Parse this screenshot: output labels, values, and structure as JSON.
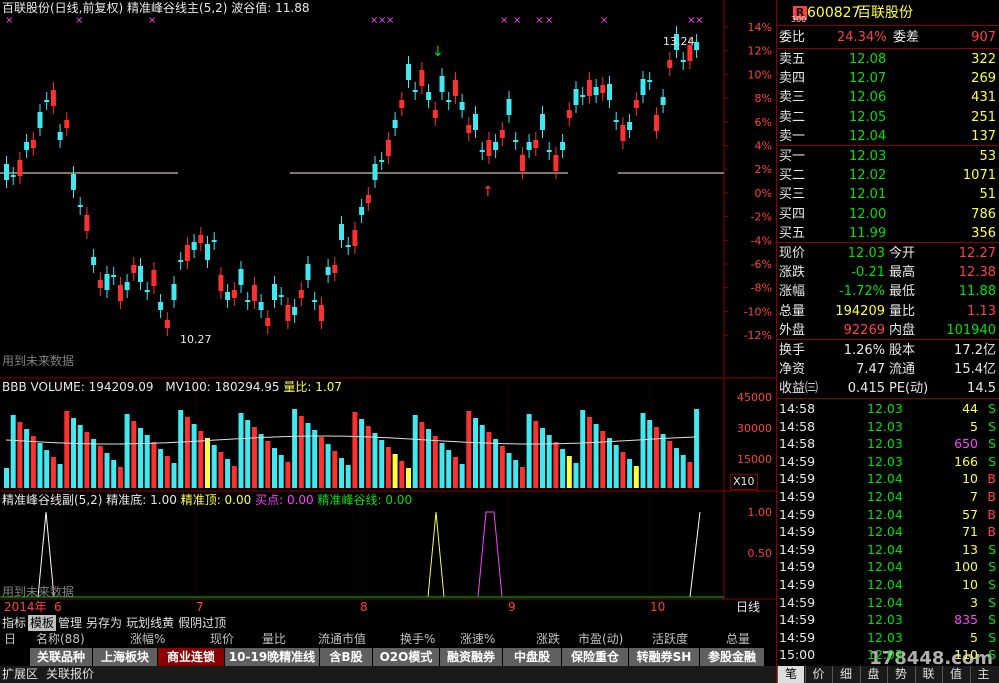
{
  "main_chart": {
    "title": "百联股份(日线,前复权)",
    "indicator_name": "精准峰谷线主(5,2)",
    "wave_label": "波谷值: 11.88",
    "price_high_label": "13.24",
    "price_low_label": "10.27",
    "future_data_label": "用到未来数据",
    "y_ticks": [
      "14%",
      "12%",
      "10%",
      "8%",
      "6%",
      "4%",
      "2%",
      "0%",
      "-2%",
      "-4%",
      "-6%",
      "-8%",
      "-10%",
      "-12%"
    ]
  },
  "volume_panel": {
    "volume_label": "BBB VOLUME: 194209.09",
    "mv_label": "MV100: 180294.95",
    "ratio_label": "量比: 1.07",
    "y_ticks": [
      "45000",
      "30000",
      "15000"
    ],
    "unit": "X10"
  },
  "sub_panel": {
    "name": "精准峰谷线副(5,2)",
    "bottom_label": "精准底: 1.00",
    "top_label": "精准顶: 0.00",
    "buy_label": "买点: 0.00",
    "line_label": "精准峰谷线: 0.00",
    "future_data_label": "用到未来数据",
    "y_ticks": [
      "1.00",
      "0.50"
    ]
  },
  "date_axis": {
    "labels": [
      "2014年",
      "6",
      "7",
      "8",
      "9",
      "10"
    ],
    "period": "日线"
  },
  "toolbar": {
    "items": [
      "指标",
      "模板",
      "管理",
      "另存为",
      "玩划线黄",
      "假阴过顶"
    ],
    "active_index": 1
  },
  "column_header": {
    "items": [
      "日",
      "名称(88)",
      "涨幅%",
      "现价",
      "量比",
      "流通市值",
      "换手%",
      "涨速%",
      "涨跌",
      "市盈(动)",
      "活跃度",
      "总量"
    ]
  },
  "tabs": {
    "items": [
      "关联品种",
      "上海板块",
      "商业连锁",
      "10-19晚精准线",
      "含B股",
      "O2O模式",
      "融资融券",
      "中盘股",
      "保险重仓",
      "转融券SH",
      "参股金融"
    ],
    "active_index": 2
  },
  "statusbar": {
    "left1": "扩展区",
    "left2": "关联报价",
    "right_tabs": [
      "笔",
      "价",
      "细",
      "盘",
      "势",
      "联",
      "值",
      "主"
    ],
    "watermark": "178448.com"
  },
  "quote": {
    "code": "600827",
    "name": "百联股份",
    "badge_r": "R",
    "badge_num": "300",
    "weibi_label": "委比",
    "weibi_value": "24.34%",
    "weicha_label": "委差",
    "weicha_value": "907",
    "asks": [
      {
        "label": "卖五",
        "price": "12.08",
        "vol": "322"
      },
      {
        "label": "卖四",
        "price": "12.07",
        "vol": "269"
      },
      {
        "label": "卖三",
        "price": "12.06",
        "vol": "431"
      },
      {
        "label": "卖二",
        "price": "12.05",
        "vol": "251"
      },
      {
        "label": "卖一",
        "price": "12.04",
        "vol": "137"
      }
    ],
    "bids": [
      {
        "label": "买一",
        "price": "12.03",
        "vol": "53"
      },
      {
        "label": "买二",
        "price": "12.02",
        "vol": "1071"
      },
      {
        "label": "买三",
        "price": "12.01",
        "vol": "51"
      },
      {
        "label": "买四",
        "price": "12.00",
        "vol": "786"
      },
      {
        "label": "买五",
        "price": "11.99",
        "vol": "356"
      }
    ],
    "stats": [
      {
        "l1": "现价",
        "v1": "12.03",
        "c1": "grn",
        "l2": "今开",
        "v2": "12.27",
        "c2": "red"
      },
      {
        "l1": "涨跌",
        "v1": "-0.21",
        "c1": "grn",
        "l2": "最高",
        "v2": "12.38",
        "c2": "red"
      },
      {
        "l1": "涨幅",
        "v1": "-1.72%",
        "c1": "grn",
        "l2": "最低",
        "v2": "11.88",
        "c2": "grn"
      },
      {
        "l1": "总量",
        "v1": "194209",
        "c1": "yel",
        "l2": "量比",
        "v2": "1.13",
        "c2": "red"
      },
      {
        "l1": "外盘",
        "v1": "92269",
        "c1": "red",
        "l2": "内盘",
        "v2": "101940",
        "c2": "grn"
      }
    ],
    "stats2": [
      {
        "l1": "换手",
        "v1": "1.26%",
        "l2": "股本",
        "v2": "17.2亿"
      },
      {
        "l1": "净资",
        "v1": "7.47",
        "l2": "流通",
        "v2": "15.4亿"
      },
      {
        "l1": "收益㈢",
        "v1": "0.415",
        "l2": "PE(动)",
        "v2": "14.5"
      }
    ],
    "ticks": [
      {
        "t": "14:58",
        "p": "12.03",
        "pc": "grn",
        "v": "44",
        "vc": "yel",
        "s": "S"
      },
      {
        "t": "14:58",
        "p": "12.03",
        "pc": "grn",
        "v": "5",
        "vc": "yel",
        "s": "S"
      },
      {
        "t": "14:58",
        "p": "12.03",
        "pc": "grn",
        "v": "650",
        "vc": "mag",
        "s": "S"
      },
      {
        "t": "14:59",
        "p": "12.03",
        "pc": "grn",
        "v": "166",
        "vc": "yel",
        "s": "S"
      },
      {
        "t": "14:59",
        "p": "12.04",
        "pc": "grn",
        "v": "10",
        "vc": "yel",
        "s": "B"
      },
      {
        "t": "14:59",
        "p": "12.04",
        "pc": "grn",
        "v": "7",
        "vc": "yel",
        "s": "B"
      },
      {
        "t": "14:59",
        "p": "12.04",
        "pc": "grn",
        "v": "57",
        "vc": "yel",
        "s": "B"
      },
      {
        "t": "14:59",
        "p": "12.04",
        "pc": "grn",
        "v": "71",
        "vc": "yel",
        "s": "B"
      },
      {
        "t": "14:59",
        "p": "12.04",
        "pc": "grn",
        "v": "13",
        "vc": "yel",
        "s": "S"
      },
      {
        "t": "14:59",
        "p": "12.04",
        "pc": "grn",
        "v": "100",
        "vc": "yel",
        "s": "S"
      },
      {
        "t": "14:59",
        "p": "12.04",
        "pc": "grn",
        "v": "10",
        "vc": "yel",
        "s": "S"
      },
      {
        "t": "14:59",
        "p": "12.04",
        "pc": "grn",
        "v": "3",
        "vc": "yel",
        "s": "S"
      },
      {
        "t": "14:59",
        "p": "12.03",
        "pc": "grn",
        "v": "835",
        "vc": "mag",
        "s": "S"
      },
      {
        "t": "14:59",
        "p": "12.03",
        "pc": "grn",
        "v": "5",
        "vc": "yel",
        "s": "S"
      },
      {
        "t": "15:00",
        "p": "12.03",
        "pc": "grn",
        "v": "110",
        "vc": "yel",
        "s": "S"
      }
    ]
  },
  "colors": {
    "up": "#ff3030",
    "down": "#40e8f0",
    "grid": "#8b0000"
  }
}
